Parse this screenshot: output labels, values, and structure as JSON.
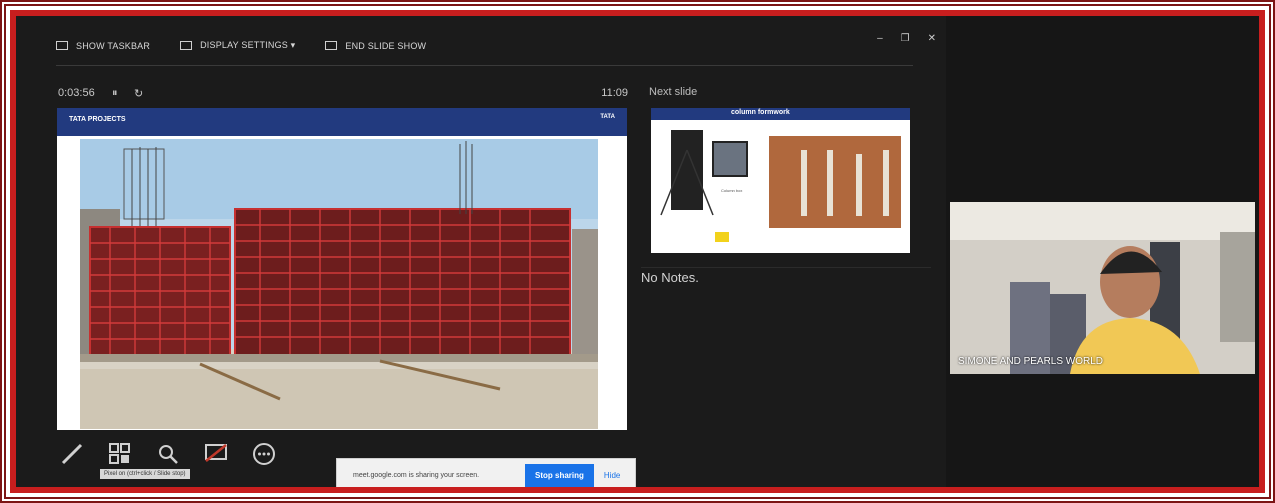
{
  "toolbar": {
    "show_taskbar": "SHOW TASKBAR",
    "display_settings": "DISPLAY SETTINGS ▾",
    "end_slide_show": "END SLIDE SHOW"
  },
  "window_controls": {
    "minimize": "–",
    "restore": "❐",
    "close": "✕"
  },
  "timer": {
    "elapsed": "0:03:56",
    "pause": "⏸",
    "reset": "↻",
    "clock": "11:09"
  },
  "slide": {
    "brand": "TATA PROJECTS",
    "logo": "TATA"
  },
  "next_slide": {
    "label": "Next slide",
    "title": "column formwork"
  },
  "notes": {
    "text": "No Notes."
  },
  "tools": {
    "tooltip": "Pixel on (ctrl+click / Slide stop)"
  },
  "share_bar": {
    "message": "meet.google.com is sharing your screen.",
    "stop": "Stop sharing",
    "hide": "Hide"
  },
  "video": {
    "label": "SIMONE AND PEARLS WORLD"
  }
}
